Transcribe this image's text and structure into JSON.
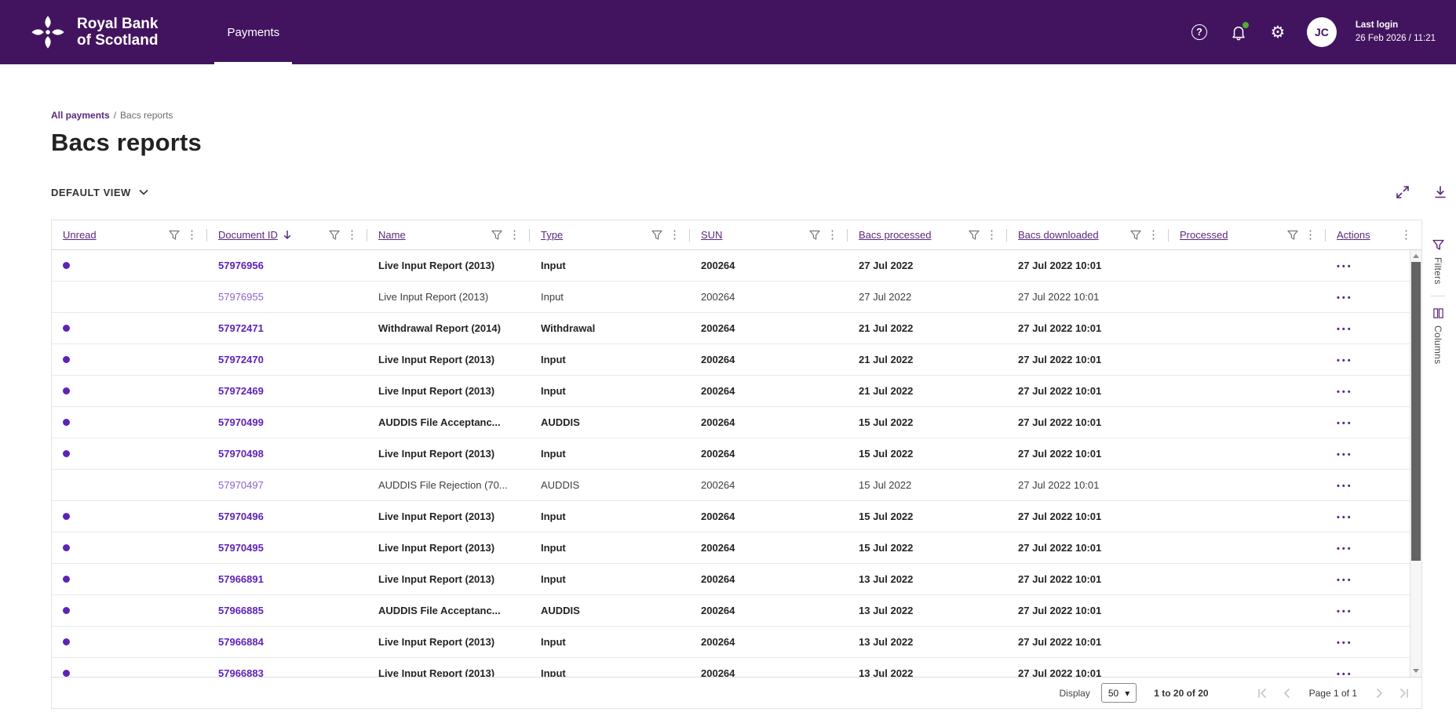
{
  "colors": {
    "topbar": "#42145f",
    "accent": "#5a287d",
    "link": "#5e22b8",
    "green": "#4cae32",
    "text": "#333333",
    "border": "#e3e3e3"
  },
  "header": {
    "brand_line1": "Royal Bank",
    "brand_line2": "of Scotland",
    "nav_payments": "Payments",
    "user_initials": "JC",
    "last_login_label": "Last login",
    "last_login_value": "26 Feb 2026 / 11:21"
  },
  "icons": {
    "help_glyph": "?",
    "gear_glyph": "⚙",
    "kebab_glyph": "⋮",
    "select_chevron_glyph": "▾"
  },
  "breadcrumb": {
    "parent": "All payments",
    "separator": "/",
    "current": "Bacs reports"
  },
  "page": {
    "title": "Bacs reports",
    "view_selector_label": "DEFAULT VIEW"
  },
  "side_rail": {
    "filters_label": "Filters",
    "columns_label": "Columns"
  },
  "table": {
    "actions_glyph": "•••",
    "columns": [
      {
        "label": "Unread",
        "filter": true,
        "menu": true
      },
      {
        "label": "Document ID",
        "sort": "desc",
        "filter": true,
        "menu": true
      },
      {
        "label": "Name",
        "filter": true,
        "menu": true
      },
      {
        "label": "Type",
        "filter": true,
        "menu": true
      },
      {
        "label": "SUN",
        "filter": true,
        "menu": true
      },
      {
        "label": "Bacs processed",
        "filter": true,
        "menu": true
      },
      {
        "label": "Bacs downloaded",
        "filter": true,
        "menu": true
      },
      {
        "label": "Processed",
        "filter": true,
        "menu": true
      },
      {
        "label": "Actions",
        "menu": true
      }
    ],
    "rows": [
      {
        "unread": true,
        "document_id": "57976956",
        "name": "Live Input Report (2013)",
        "type": "Input",
        "sun": "200264",
        "bacs_processed": "27 Jul 2022",
        "bacs_downloaded": "27 Jul 2022 10:01",
        "processed": ""
      },
      {
        "unread": false,
        "document_id": "57976955",
        "name": "Live Input Report (2013)",
        "type": "Input",
        "sun": "200264",
        "bacs_processed": "27 Jul 2022",
        "bacs_downloaded": "27 Jul 2022 10:01",
        "processed": ""
      },
      {
        "unread": true,
        "document_id": "57972471",
        "name": "Withdrawal Report (2014)",
        "type": "Withdrawal",
        "sun": "200264",
        "bacs_processed": "21 Jul 2022",
        "bacs_downloaded": "27 Jul 2022 10:01",
        "processed": ""
      },
      {
        "unread": true,
        "document_id": "57972470",
        "name": "Live Input Report (2013)",
        "type": "Input",
        "sun": "200264",
        "bacs_processed": "21 Jul 2022",
        "bacs_downloaded": "27 Jul 2022 10:01",
        "processed": ""
      },
      {
        "unread": true,
        "document_id": "57972469",
        "name": "Live Input Report (2013)",
        "type": "Input",
        "sun": "200264",
        "bacs_processed": "21 Jul 2022",
        "bacs_downloaded": "27 Jul 2022 10:01",
        "processed": ""
      },
      {
        "unread": true,
        "document_id": "57970499",
        "name": "AUDDIS File Acceptanc...",
        "type": "AUDDIS",
        "sun": "200264",
        "bacs_processed": "15 Jul 2022",
        "bacs_downloaded": "27 Jul 2022 10:01",
        "processed": ""
      },
      {
        "unread": true,
        "document_id": "57970498",
        "name": "Live Input Report (2013)",
        "type": "Input",
        "sun": "200264",
        "bacs_processed": "15 Jul 2022",
        "bacs_downloaded": "27 Jul 2022 10:01",
        "processed": ""
      },
      {
        "unread": false,
        "document_id": "57970497",
        "name": "AUDDIS File Rejection (70...",
        "type": "AUDDIS",
        "sun": "200264",
        "bacs_processed": "15 Jul 2022",
        "bacs_downloaded": "27 Jul 2022 10:01",
        "processed": ""
      },
      {
        "unread": true,
        "document_id": "57970496",
        "name": "Live Input Report (2013)",
        "type": "Input",
        "sun": "200264",
        "bacs_processed": "15 Jul 2022",
        "bacs_downloaded": "27 Jul 2022 10:01",
        "processed": ""
      },
      {
        "unread": true,
        "document_id": "57970495",
        "name": "Live Input Report (2013)",
        "type": "Input",
        "sun": "200264",
        "bacs_processed": "15 Jul 2022",
        "bacs_downloaded": "27 Jul 2022 10:01",
        "processed": ""
      },
      {
        "unread": true,
        "document_id": "57966891",
        "name": "Live Input Report (2013)",
        "type": "Input",
        "sun": "200264",
        "bacs_processed": "13 Jul 2022",
        "bacs_downloaded": "27 Jul 2022 10:01",
        "processed": ""
      },
      {
        "unread": true,
        "document_id": "57966885",
        "name": "AUDDIS File Acceptanc...",
        "type": "AUDDIS",
        "sun": "200264",
        "bacs_processed": "13 Jul 2022",
        "bacs_downloaded": "27 Jul 2022 10:01",
        "processed": ""
      },
      {
        "unread": true,
        "document_id": "57966884",
        "name": "Live Input Report (2013)",
        "type": "Input",
        "sun": "200264",
        "bacs_processed": "13 Jul 2022",
        "bacs_downloaded": "27 Jul 2022 10:01",
        "processed": ""
      },
      {
        "unread": true,
        "document_id": "57966883",
        "name": "Live Input Report (2013)",
        "type": "Input",
        "sun": "200264",
        "bacs_processed": "13 Jul 2022",
        "bacs_downloaded": "27 Jul 2022 10:01",
        "processed": ""
      }
    ]
  },
  "pagination": {
    "display_label": "Display",
    "page_size": "50",
    "range_text": "1 to 20 of 20",
    "page_text": "Page 1 of 1"
  }
}
